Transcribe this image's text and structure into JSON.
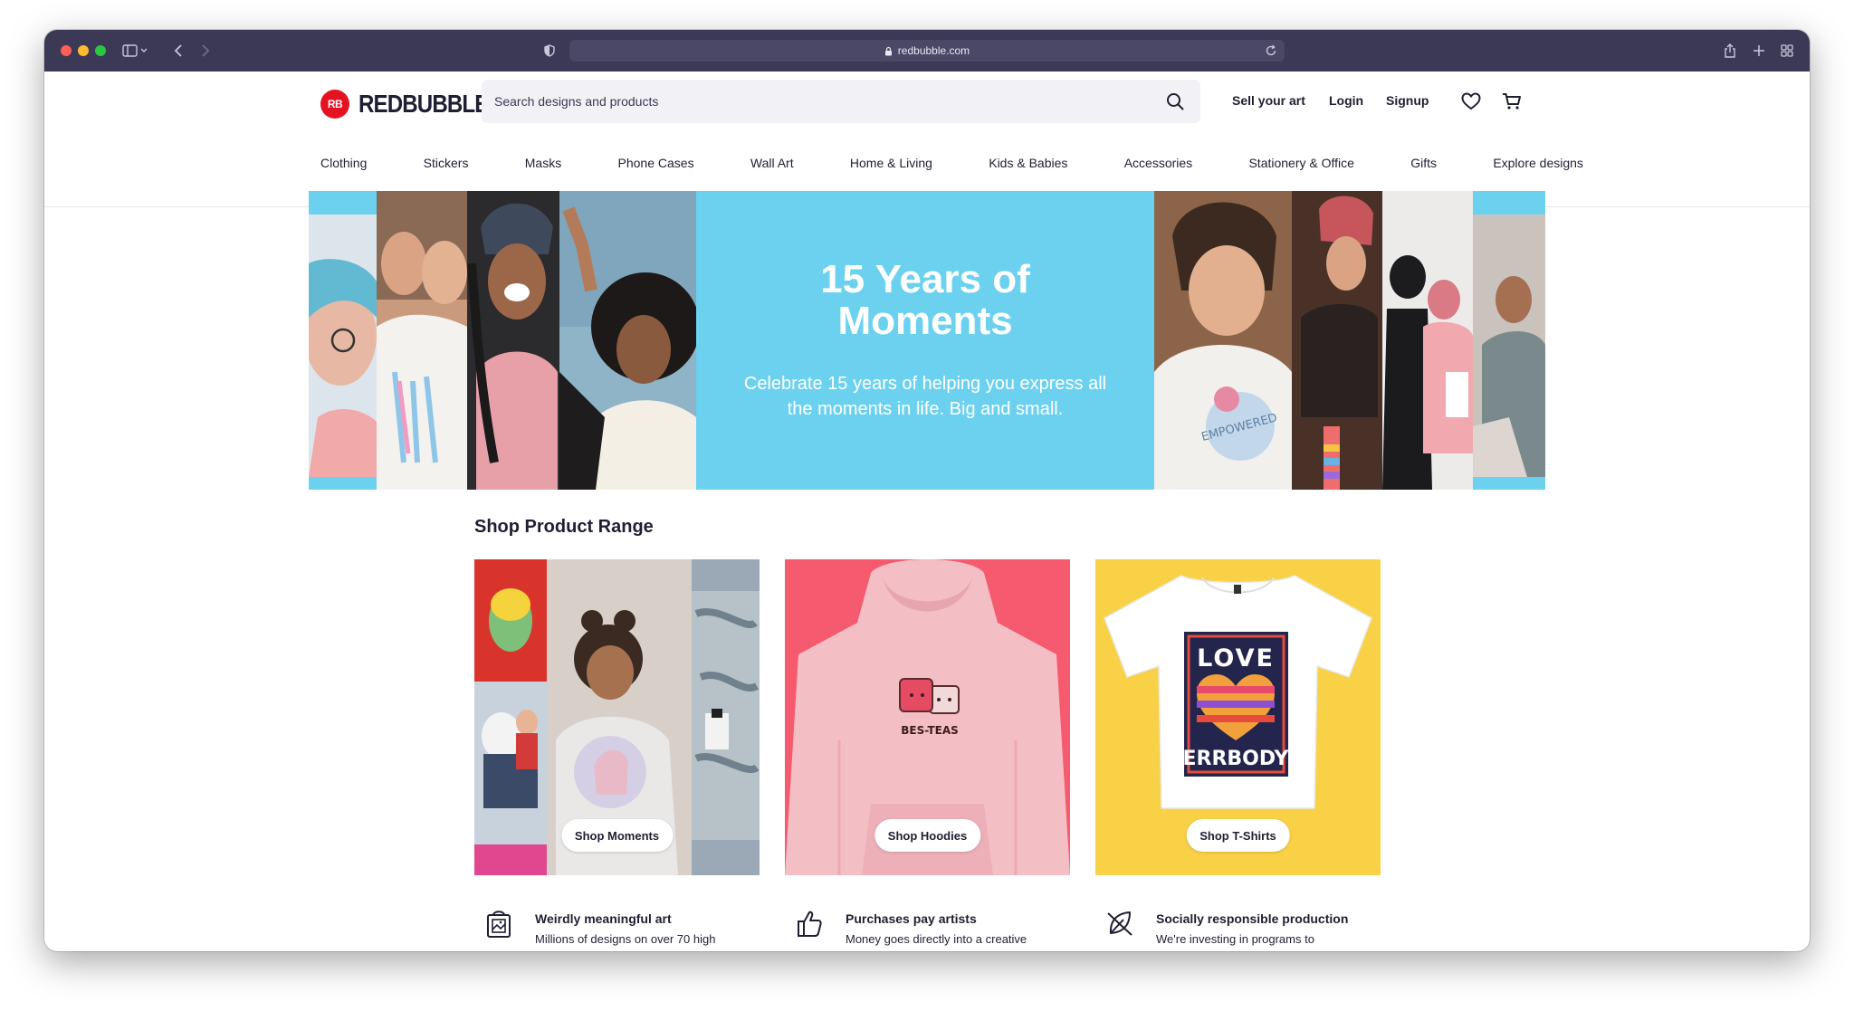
{
  "browser": {
    "url": "redbubble.com"
  },
  "header": {
    "logo_mark": "RB",
    "logo_text": "REDBUBBLE",
    "search_placeholder": "Search designs and products",
    "sell_label": "Sell your art",
    "login_label": "Login",
    "signup_label": "Signup",
    "icons": [
      "heart-icon",
      "cart-icon",
      "search-icon"
    ]
  },
  "nav": {
    "items": [
      "Clothing",
      "Stickers",
      "Masks",
      "Phone Cases",
      "Wall Art",
      "Home & Living",
      "Kids & Babies",
      "Accessories",
      "Stationery & Office",
      "Gifts",
      "Explore designs"
    ]
  },
  "hero": {
    "title": "15 Years of Moments",
    "subtitle": "Celebrate 15 years of helping you express all the moments in life. Big and small.",
    "background_color": "#6cd1ef"
  },
  "product_range": {
    "title": "Shop Product Range",
    "cards": [
      {
        "button": "Shop Moments",
        "background": "#e0478f"
      },
      {
        "button": "Shop Hoodies",
        "background": "#f55a6e",
        "artwork_text": "BES-TEAS"
      },
      {
        "button": "Shop T-Shirts",
        "background": "#f9d147",
        "artwork_text_top": "LOVE",
        "artwork_text_bottom": "ERRBODY"
      }
    ]
  },
  "features": [
    {
      "icon": "art-bag-icon",
      "title": "Weirdly meaningful art",
      "text": "Millions of designs on over 70 high"
    },
    {
      "icon": "thumbs-up-icon",
      "title": "Purchases pay artists",
      "text": "Money goes directly into a creative"
    },
    {
      "icon": "leaf-icon",
      "title": "Socially responsible production",
      "text": "We're investing in programs to"
    }
  ],
  "colors": {
    "brand_red": "#e41321",
    "chrome": "#3b3955",
    "text": "#1f1f33"
  }
}
